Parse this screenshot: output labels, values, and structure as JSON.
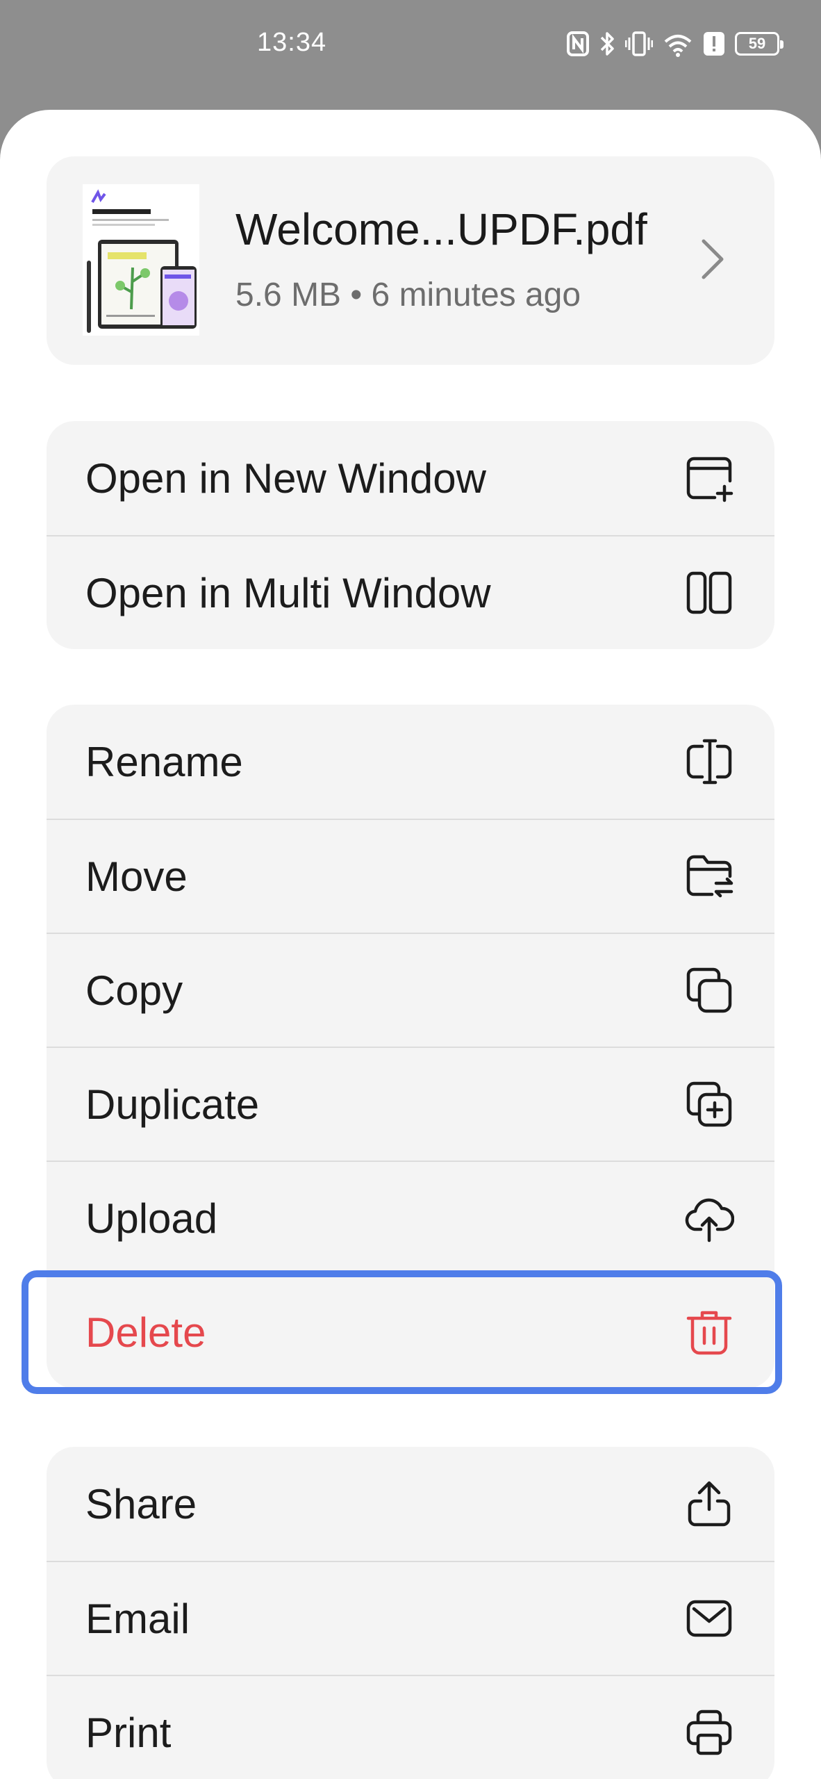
{
  "status_bar": {
    "time": "13:34",
    "battery": "59",
    "icons": [
      "nfc-icon",
      "bluetooth-icon",
      "vibrate-icon",
      "wifi-icon",
      "alert-icon",
      "battery-icon"
    ]
  },
  "file": {
    "name": "Welcome...UPDF.pdf",
    "meta": "5.6 MB • 6 minutes ago"
  },
  "window_group": [
    {
      "label": "Open in New Window",
      "icon": "new-window-icon"
    },
    {
      "label": "Open in Multi Window",
      "icon": "multi-window-icon"
    }
  ],
  "file_group": [
    {
      "label": "Rename",
      "icon": "rename-icon"
    },
    {
      "label": "Move",
      "icon": "move-folder-icon"
    },
    {
      "label": "Copy",
      "icon": "copy-icon"
    },
    {
      "label": "Duplicate",
      "icon": "duplicate-icon"
    },
    {
      "label": "Upload",
      "icon": "cloud-upload-icon"
    },
    {
      "label": "Delete",
      "icon": "trash-icon"
    }
  ],
  "share_group": [
    {
      "label": "Share",
      "icon": "share-icon"
    },
    {
      "label": "Email",
      "icon": "email-icon"
    },
    {
      "label": "Print",
      "icon": "printer-icon"
    }
  ],
  "colors": {
    "danger": "#e5484d",
    "highlight": "#4f7de9",
    "group_bg": "#f4f4f4"
  }
}
